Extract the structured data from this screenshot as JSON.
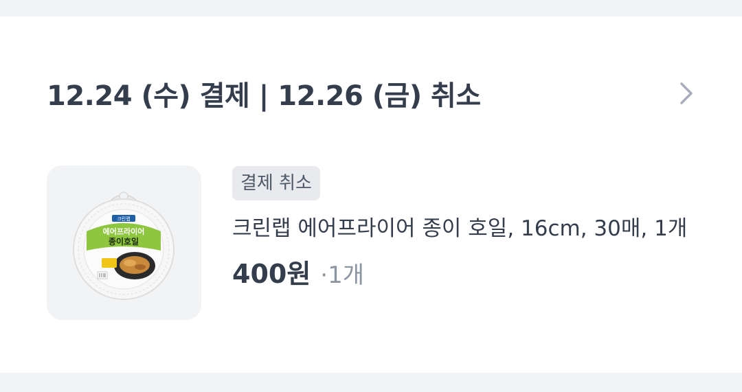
{
  "order": {
    "header_title": "12.24 (수) 결제 | 12.26 (금) 취소",
    "chevron_icon": "chevron-right-icon"
  },
  "item": {
    "status_badge": "결제 취소",
    "name": "크린랩 에어프라이어 종이 호일, 16cm, 30매, 1개",
    "price": "400원",
    "separator": "·",
    "quantity": "1개",
    "thumbnail": {
      "brand_text": "크린랩",
      "product_text_line1": "에어프라이어",
      "product_text_line2": "종이호일"
    }
  },
  "colors": {
    "page_background": "#f2f3f5",
    "card_background": "#ffffff",
    "text_primary": "#333d4b",
    "text_secondary": "#8b95a1",
    "badge_background": "#e8eaee"
  }
}
